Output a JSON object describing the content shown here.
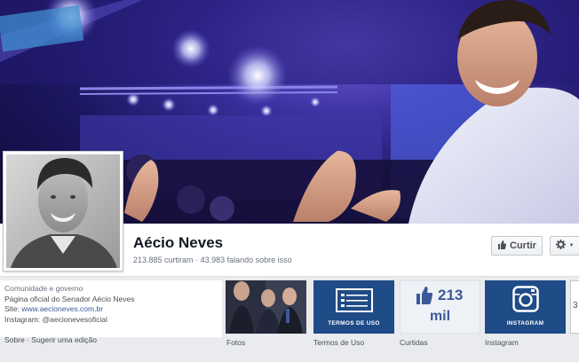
{
  "page": {
    "name": "Aécio Neves",
    "likes_text": "213.885 curtiram",
    "separator": "·",
    "talking_text": "43.983 falando sobre isso"
  },
  "actions": {
    "like_label": "Curtir",
    "like_icon": "thumbs-up-icon",
    "settings_icon": "gear-icon",
    "settings_caret": "▼"
  },
  "about": {
    "category": "Comunidade e governo",
    "description": "Página oficial do Senador Aécio Neves",
    "site_label": "Site:",
    "site_value": "www.aecioneves.com.br",
    "instagram_label": "Instagram:",
    "instagram_value": "@aecionevesoficial",
    "footer_about": "Sobre",
    "footer_separator": "·",
    "footer_suggest": "Sugerir uma edição"
  },
  "apps": [
    {
      "label": "Fotos"
    },
    {
      "label": "Termos de Uso",
      "tile_text": "TERMOS DE USO"
    },
    {
      "label": "Curtidas",
      "count": "213",
      "unit": "mil"
    },
    {
      "label": "Instagram",
      "tile_text": "INSTAGRAM"
    }
  ],
  "more_apps": {
    "count": "3"
  },
  "colors": {
    "facebook_blue": "#3b5998",
    "tile_blue": "#1f4b87",
    "cover_purple": "#3a2f9e"
  }
}
